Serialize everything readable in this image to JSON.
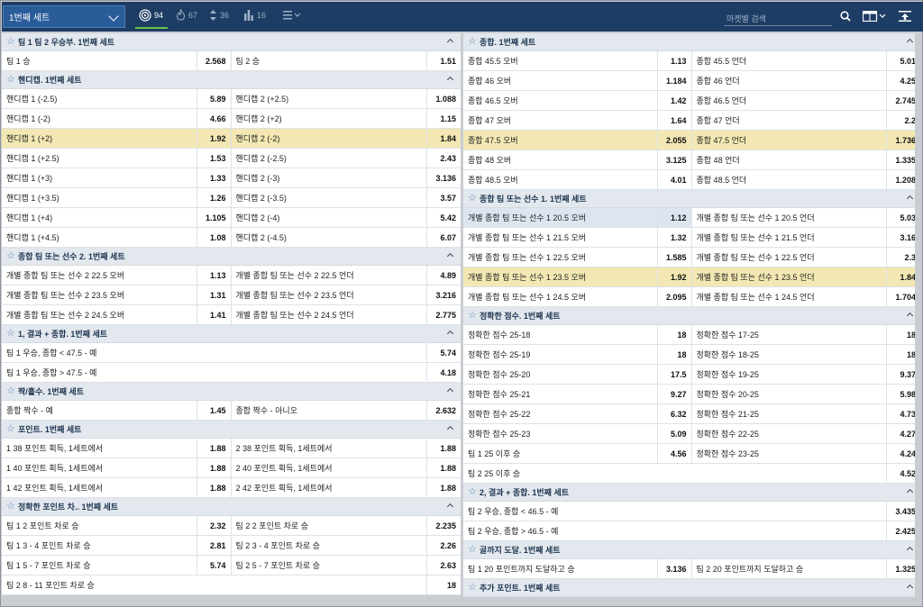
{
  "topbar": {
    "selector": "1번째 세트",
    "filters": [
      {
        "icon": "target-icon",
        "count": "94"
      },
      {
        "icon": "fire-icon",
        "count": "67"
      },
      {
        "icon": "updown-icon",
        "count": "36"
      },
      {
        "icon": "bars-icon",
        "count": "16"
      }
    ],
    "search_placeholder": "마켓별 검색"
  },
  "left": [
    {
      "title": "팀 1 팀 2 우승부. 1번째 세트",
      "rows": [
        [
          {
            "l": "팀 1 승",
            "o": "2.568"
          },
          {
            "l": "팀 2 승",
            "o": "1.51"
          }
        ]
      ]
    },
    {
      "title": "핸디캡. 1번째 세트",
      "rows": [
        [
          {
            "l": "핸디캡 1 (-2.5)",
            "o": "5.89"
          },
          {
            "l": "핸디캡 2 (+2.5)",
            "o": "1.088"
          }
        ],
        [
          {
            "l": "핸디캡 1 (-2)",
            "o": "4.66"
          },
          {
            "l": "핸디캡 2 (+2)",
            "o": "1.15"
          }
        ],
        [
          {
            "l": "핸디캡 1 (+2)",
            "o": "1.92"
          },
          {
            "l": "핸디캡 2 (-2)",
            "o": "1.84"
          }
        ],
        [
          {
            "l": "핸디캡 1 (+2.5)",
            "o": "1.53"
          },
          {
            "l": "핸디캡 2 (-2.5)",
            "o": "2.43"
          }
        ],
        [
          {
            "l": "핸디캡 1 (+3)",
            "o": "1.33"
          },
          {
            "l": "핸디캡 2 (-3)",
            "o": "3.136"
          }
        ],
        [
          {
            "l": "핸디캡 1 (+3.5)",
            "o": "1.26"
          },
          {
            "l": "핸디캡 2 (-3.5)",
            "o": "3.57"
          }
        ],
        [
          {
            "l": "핸디캡 1 (+4)",
            "o": "1.105"
          },
          {
            "l": "핸디캡 2 (-4)",
            "o": "5.42"
          }
        ],
        [
          {
            "l": "핸디캡 1 (+4.5)",
            "o": "1.08"
          },
          {
            "l": "핸디캡 2 (-4.5)",
            "o": "6.07"
          }
        ]
      ]
    },
    {
      "title": "종합 팀 또는 선수 2. 1번째 세트",
      "rows": [
        [
          {
            "l": "개별 종합 팀 또는 선수 2 22.5 오버",
            "o": "1.13"
          },
          {
            "l": "개별 종합 팀 또는 선수 2 22.5 언더",
            "o": "4.89"
          }
        ],
        [
          {
            "l": "개별 종합 팀 또는 선수 2 23.5 오버",
            "o": "1.31"
          },
          {
            "l": "개별 종합 팀 또는 선수 2 23.5 언더",
            "o": "3.216"
          }
        ],
        [
          {
            "l": "개별 종합 팀 또는 선수 2 24.5 오버",
            "o": "1.41"
          },
          {
            "l": "개별 종합 팀 또는 선수 2 24.5 언더",
            "o": "2.775"
          }
        ]
      ]
    },
    {
      "title": "1, 결과 + 종합. 1번째 세트",
      "rows": [
        [
          {
            "l": "팀 1 우승, 종합 < 47.5 - 예",
            "o": "5.74"
          }
        ],
        [
          {
            "l": "팀 1 우승, 종합 > 47.5 - 예",
            "o": "4.18"
          }
        ]
      ]
    },
    {
      "title": "짝/홀수. 1번째 세트",
      "rows": [
        [
          {
            "l": "종합 짝수 - 예",
            "o": "1.45"
          },
          {
            "l": "종합 짝수 - 아니오",
            "o": "2.632"
          }
        ]
      ]
    },
    {
      "title": "포인트. 1번째 세트",
      "rows": [
        [
          {
            "l": "1 38 포인트 획득, 1세트에서",
            "o": "1.88"
          },
          {
            "l": "2 38 포인트 획득, 1세트에서",
            "o": "1.88"
          }
        ],
        [
          {
            "l": "1 40 포인트 획득, 1세트에서",
            "o": "1.88"
          },
          {
            "l": "2 40 포인트 획득, 1세트에서",
            "o": "1.88"
          }
        ],
        [
          {
            "l": "1 42 포인트 획득, 1세트에서",
            "o": "1.88"
          },
          {
            "l": "2 42 포인트 획득, 1세트에서",
            "o": "1.88"
          }
        ]
      ]
    },
    {
      "title": "정확한 포인트 차.. 1번째 세트",
      "rows": [
        [
          {
            "l": "팀 1 2 포인트 차로 승",
            "o": "2.32"
          },
          {
            "l": "팀 2 2 포인트 차로 승",
            "o": "2.235"
          }
        ],
        [
          {
            "l": "팀 1 3 - 4 포인트 차로 승",
            "o": "2.81"
          },
          {
            "l": "팀 2 3 - 4 포인트 차로 승",
            "o": "2.26"
          }
        ],
        [
          {
            "l": "팀 1 5 - 7 포인트 차로 승",
            "o": "5.74"
          },
          {
            "l": "팀 2 5 - 7 포인트 차로 승",
            "o": "2.63"
          }
        ],
        [
          {
            "l": "팀 2 8 - 11 포인트 차로 승",
            "o": "18"
          }
        ]
      ]
    }
  ],
  "right": [
    {
      "title": "종합. 1번째 세트",
      "rows": [
        [
          {
            "l": "종합 45.5 오버",
            "o": "1.13"
          },
          {
            "l": "종합 45.5 언더",
            "o": "5.01"
          }
        ],
        [
          {
            "l": "종합 46 오버",
            "o": "1.184"
          },
          {
            "l": "종합 46 언더",
            "o": "4.25"
          }
        ],
        [
          {
            "l": "종합 46.5 오버",
            "o": "1.42"
          },
          {
            "l": "종합 46.5 언더",
            "o": "2.745"
          }
        ],
        [
          {
            "l": "종합 47 오버",
            "o": "1.64"
          },
          {
            "l": "종합 47 언더",
            "o": "2.2"
          }
        ],
        [
          {
            "l": "종합 47.5 오버",
            "o": "2.055"
          },
          {
            "l": "종합 47.5 언더",
            "o": "1.736"
          }
        ],
        [
          {
            "l": "종합 48 오버",
            "o": "3.125"
          },
          {
            "l": "종합 48 언더",
            "o": "1.335"
          }
        ],
        [
          {
            "l": "종합 48.5 오버",
            "o": "4.01"
          },
          {
            "l": "종합 48.5 언더",
            "o": "1.208"
          }
        ]
      ]
    },
    {
      "title": "종합 팀 또는 선수 1. 1번째 세트",
      "rows": [
        [
          {
            "l": "개별 종합 팀 또는 선수 1 20.5 오버",
            "o": "1.12"
          },
          {
            "l": "개별 종합 팀 또는 선수 1 20.5 언더",
            "o": "5.03"
          }
        ],
        [
          {
            "l": "개별 종합 팀 또는 선수 1 21.5 오버",
            "o": "1.32"
          },
          {
            "l": "개별 종합 팀 또는 선수 1 21.5 언더",
            "o": "3.16"
          }
        ],
        [
          {
            "l": "개별 종합 팀 또는 선수 1 22.5 오버",
            "o": "1.585"
          },
          {
            "l": "개별 종합 팀 또는 선수 1 22.5 언더",
            "o": "2.3"
          }
        ],
        [
          {
            "l": "개별 종합 팀 또는 선수 1 23.5 오버",
            "o": "1.92"
          },
          {
            "l": "개별 종합 팀 또는 선수 1 23.5 언더",
            "o": "1.84"
          }
        ],
        [
          {
            "l": "개별 종합 팀 또는 선수 1 24.5 오버",
            "o": "2.095"
          },
          {
            "l": "개별 종합 팀 또는 선수 1 24.5 언더",
            "o": "1.704"
          }
        ]
      ]
    },
    {
      "title": "정확한 점수. 1번째 세트",
      "rows": [
        [
          {
            "l": "정확한 점수 25-18",
            "o": "18"
          },
          {
            "l": "정확한 점수 17-25",
            "o": "18"
          }
        ],
        [
          {
            "l": "정확한 점수 25-19",
            "o": "18"
          },
          {
            "l": "정확한 점수 18-25",
            "o": "18"
          }
        ],
        [
          {
            "l": "정확한 점수 25-20",
            "o": "17.5"
          },
          {
            "l": "정확한 점수 19-25",
            "o": "9.37"
          }
        ],
        [
          {
            "l": "정확한 점수 25-21",
            "o": "9.27"
          },
          {
            "l": "정확한 점수 20-25",
            "o": "5.98"
          }
        ],
        [
          {
            "l": "정확한 점수 25-22",
            "o": "6.32"
          },
          {
            "l": "정확한 점수 21-25",
            "o": "4.73"
          }
        ],
        [
          {
            "l": "정확한 점수 25-23",
            "o": "5.09"
          },
          {
            "l": "정확한 점수 22-25",
            "o": "4.27"
          }
        ],
        [
          {
            "l": "팀 1 25 이후 승",
            "o": "4.56"
          },
          {
            "l": "정확한 점수 23-25",
            "o": "4.24"
          }
        ],
        [
          {
            "l": "팀 2 25 이후 승",
            "o": "4.52"
          }
        ]
      ]
    },
    {
      "title": "2, 결과 + 종합. 1번째 세트",
      "rows": [
        [
          {
            "l": "팀 2 우승, 종합 < 46.5 - 예",
            "o": "3.435"
          }
        ],
        [
          {
            "l": "팀 2 우승, 종합 > 46.5 - 예",
            "o": "2.425"
          }
        ]
      ]
    },
    {
      "title": "골까지 도달. 1번째 세트",
      "rows": [
        [
          {
            "l": "팀 1 20 포인트까지 도달하고 승",
            "o": "3.136"
          },
          {
            "l": "팀 2 20 포인트까지 도달하고 승",
            "o": "1.325"
          }
        ]
      ]
    },
    {
      "title": "추가 포인트. 1번째 세트",
      "rows": []
    }
  ],
  "highlight": {
    "left": [
      1,
      2
    ],
    "right": [
      0,
      4
    ],
    "right2": [
      1,
      3
    ]
  },
  "colors": {
    "topbar": "#1e3d64",
    "highlight": "#f3e8b3",
    "accent": "#6cc04a"
  }
}
